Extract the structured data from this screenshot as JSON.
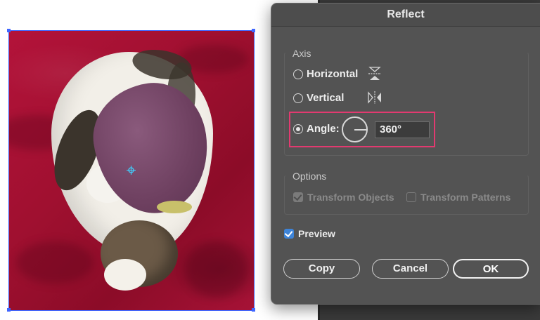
{
  "dialog": {
    "title": "Reflect",
    "axis": {
      "group_label": "Axis",
      "horizontal_label": "Horizontal",
      "vertical_label": "Vertical",
      "angle_label": "Angle:",
      "angle_value": "360°",
      "selected": "angle"
    },
    "options": {
      "group_label": "Options",
      "transform_objects_label": "Transform Objects",
      "transform_objects_checked": true,
      "transform_patterns_label": "Transform Patterns",
      "transform_patterns_checked": false,
      "enabled": false
    },
    "preview": {
      "label": "Preview",
      "checked": true
    },
    "buttons": {
      "copy": "Copy",
      "cancel": "Cancel",
      "ok": "OK"
    }
  },
  "colors": {
    "dialog_bg": "#535353",
    "highlight": "#e23a70",
    "selection": "#3f66ff",
    "checkbox_accent": "#3d84d9"
  },
  "canvas": {
    "artwork_subject": "photo-artwork-icon"
  }
}
